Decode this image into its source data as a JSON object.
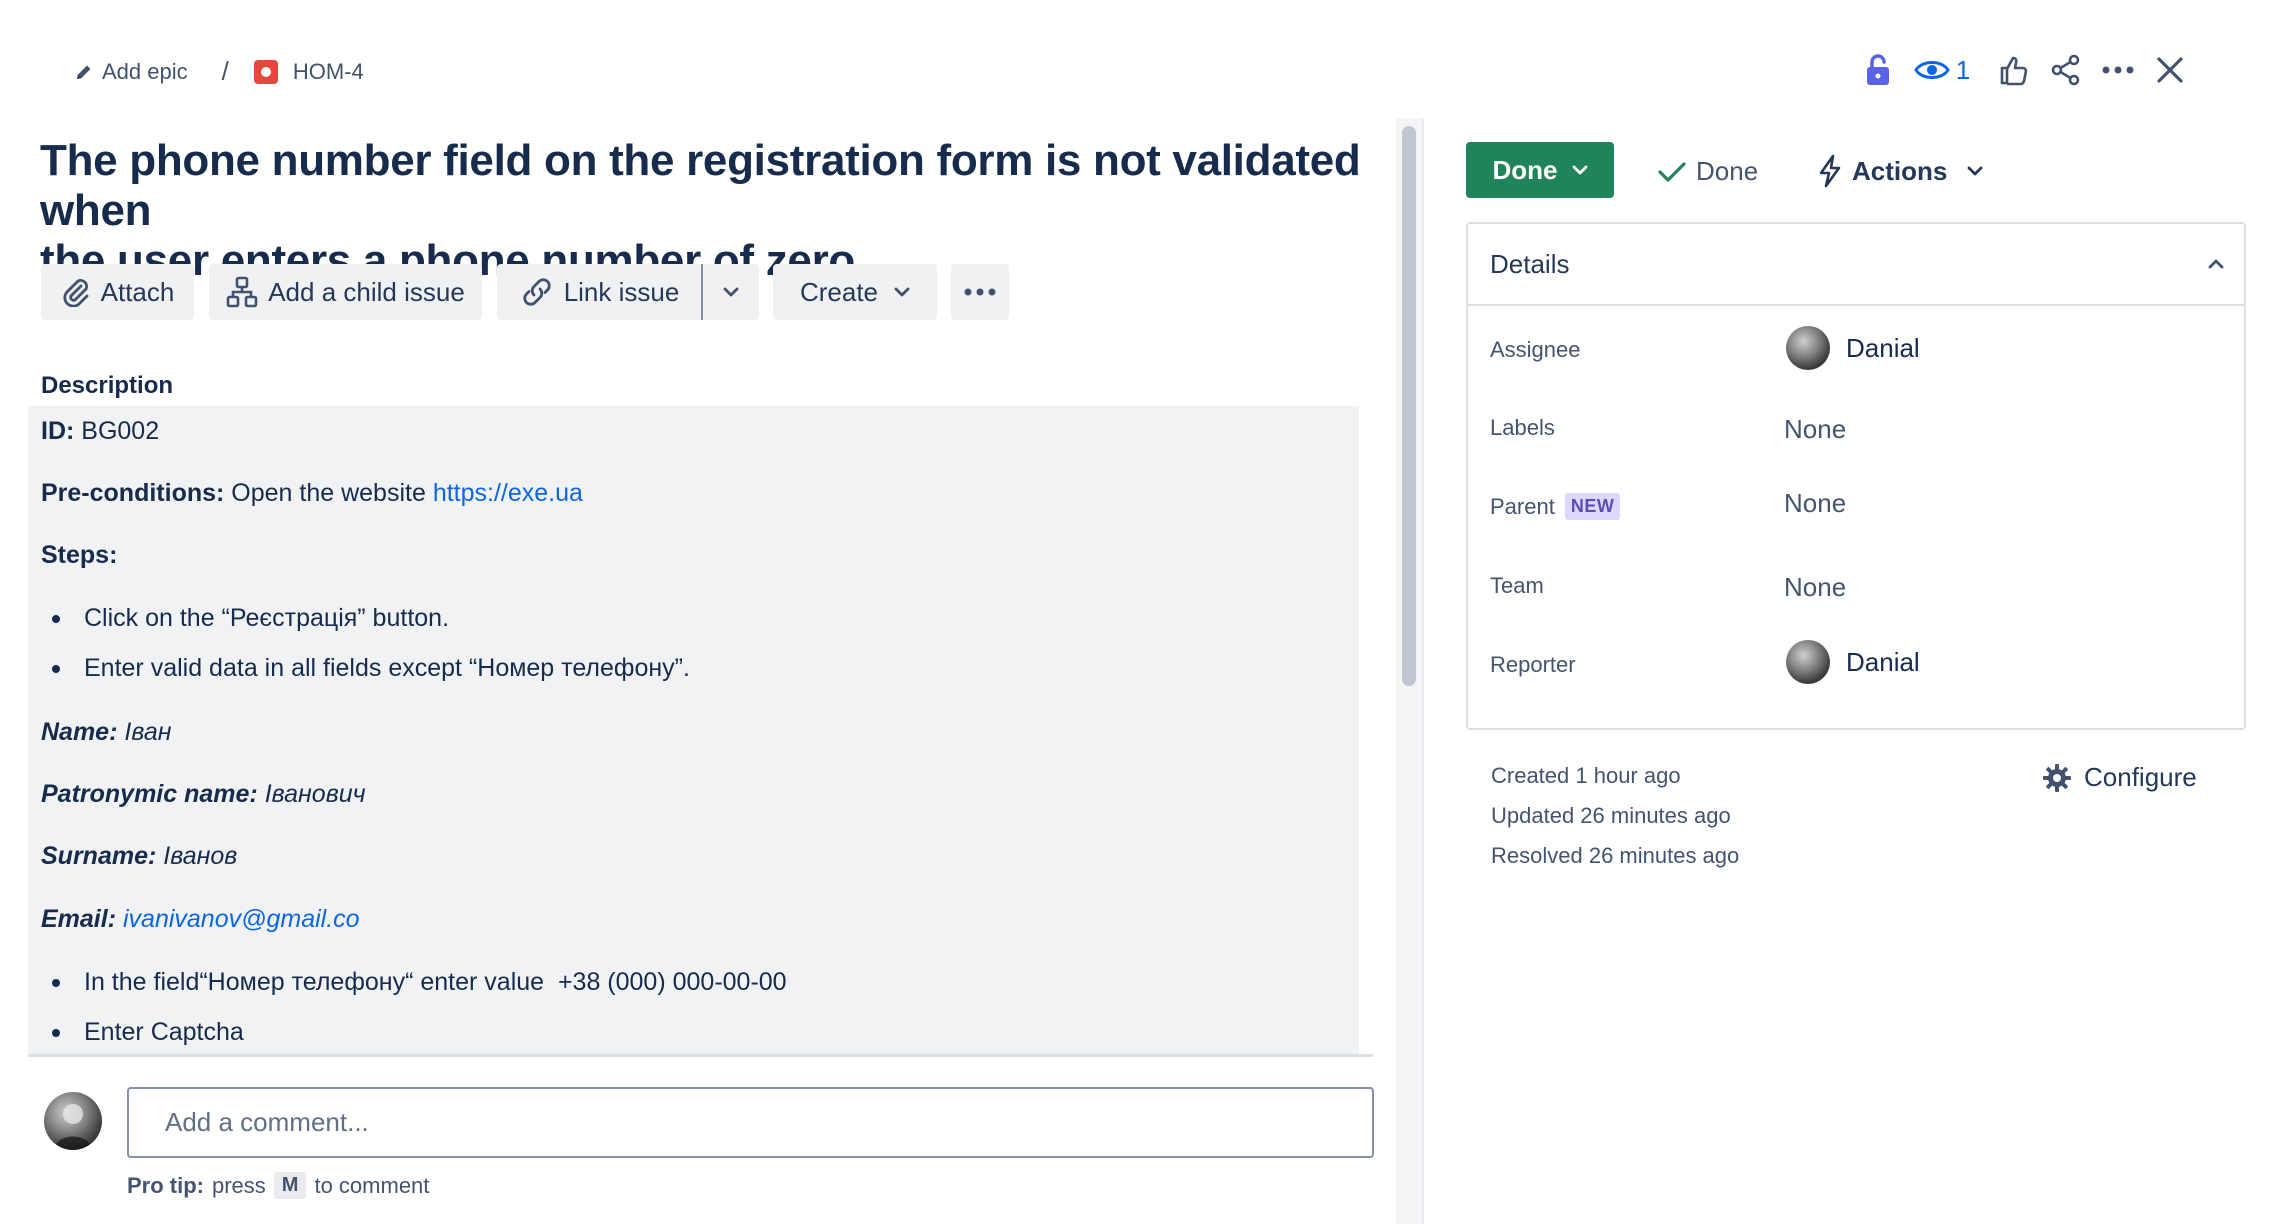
{
  "breadcrumb": {
    "add_epic": "Add epic",
    "separator": "/",
    "issue_key": "HOM-4"
  },
  "top_actions": {
    "watch_count": "1"
  },
  "issue": {
    "title_line1": "The phone number field on the registration form is not validated when",
    "title_line2": "the user enters a phone number of zero."
  },
  "toolbar": {
    "attach": "Attach",
    "add_child": "Add a child issue",
    "link_issue": "Link issue",
    "create": "Create"
  },
  "description": {
    "label": "Description",
    "id_label": "ID:",
    "id_value": " BG002",
    "precond_label": "Pre-conditions:",
    "precond_text": " Open the website ",
    "precond_link": "https://exe.ua",
    "steps_label": "Steps:",
    "step1": "Click on the “Реєстрація” button.",
    "step2": "Enter valid data in all fields except “Номер телефону”.",
    "name_label": "Name:",
    "name_value": " Іван",
    "patronymic_label": "Patronymic name:",
    "patronymic_value": " Іванович",
    "surname_label": "Surname:",
    "surname_value": " Іванов",
    "email_label": "Email:",
    "email_value": "ivanivanov@gmail.co",
    "step3": "In the field“Номер телефону“ enter value  +38 (000) 000-00-00",
    "step4": "Enter Captcha"
  },
  "comment": {
    "placeholder": "Add a comment...",
    "protip_label": "Pro tip:",
    "protip_press": "press",
    "protip_key": "M",
    "protip_suffix": "to comment"
  },
  "status": {
    "button": "Done",
    "resolution": "Done",
    "actions": "Actions"
  },
  "details": {
    "header": "Details",
    "assignee_label": "Assignee",
    "assignee_value": "Danial",
    "labels_label": "Labels",
    "labels_value": "None",
    "parent_label": "Parent",
    "parent_badge": "NEW",
    "parent_value": "None",
    "team_label": "Team",
    "team_value": "None",
    "reporter_label": "Reporter",
    "reporter_value": "Danial"
  },
  "meta": {
    "created": "Created 1 hour ago",
    "updated": "Updated 26 minutes ago",
    "resolved": "Resolved 26 minutes ago",
    "configure": "Configure"
  },
  "colors": {
    "accent_blue": "#0c66e4",
    "done_green": "#1f845a",
    "lock_blue": "#5a63e6",
    "epic_red": "#e2483d"
  }
}
